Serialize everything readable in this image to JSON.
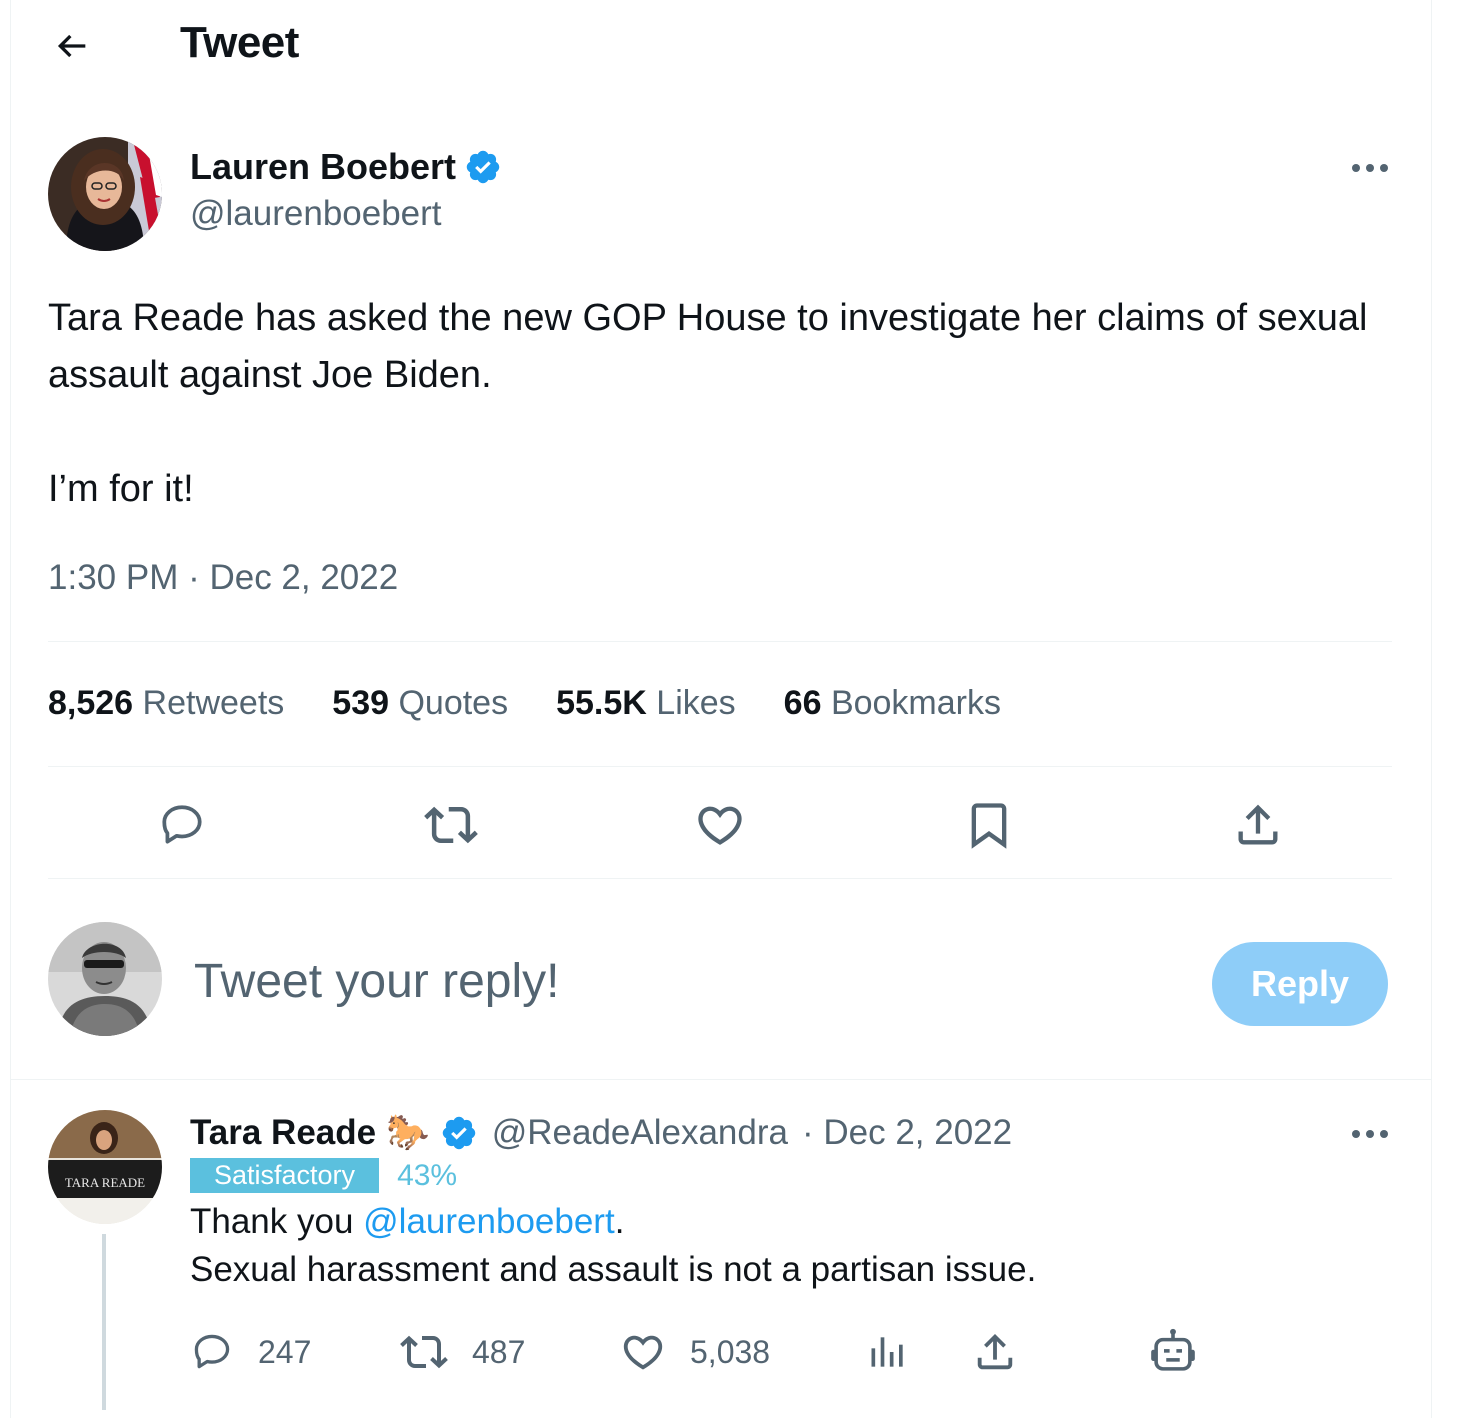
{
  "header": {
    "title": "Tweet",
    "back_icon": "arrow-left-icon"
  },
  "tweet": {
    "author_name": "Lauren Boebert",
    "author_handle": "@laurenboebert",
    "verified": true,
    "text_line1": "Tara Reade has asked the new GOP House to investigate her claims of sexual assault against Joe Biden.",
    "text_line2": "I’m for it!",
    "timestamp": "1:30 PM · Dec 2, 2022",
    "stats": {
      "retweets_count": "8,526",
      "retweets_label": "Retweets",
      "quotes_count": "539",
      "quotes_label": "Quotes",
      "likes_count": "55.5K",
      "likes_label": "Likes",
      "bookmarks_count": "66",
      "bookmarks_label": "Bookmarks"
    }
  },
  "composer": {
    "placeholder": "Tweet your reply!",
    "button_label": "Reply"
  },
  "reply": {
    "author_name": "Tara Reade",
    "emoji": "🐎",
    "author_handle": "@ReadeAlexandra",
    "date": "· Dec 2, 2022",
    "badge_label": "Satisfactory",
    "badge_percent": "43%",
    "text_prefix": "Thank you ",
    "mention": "@laurenboebert",
    "text_suffix": ".",
    "text_line2": "Sexual harassment and assault is not a partisan issue.",
    "avatar_caption": "TARA READE",
    "replies": "247",
    "retweets": "487",
    "likes": "5,038"
  },
  "colors": {
    "accent": "#1d9bf0",
    "reply_button": "#8ecdf8",
    "badge": "#5bc0de",
    "muted_text": "#536471"
  }
}
